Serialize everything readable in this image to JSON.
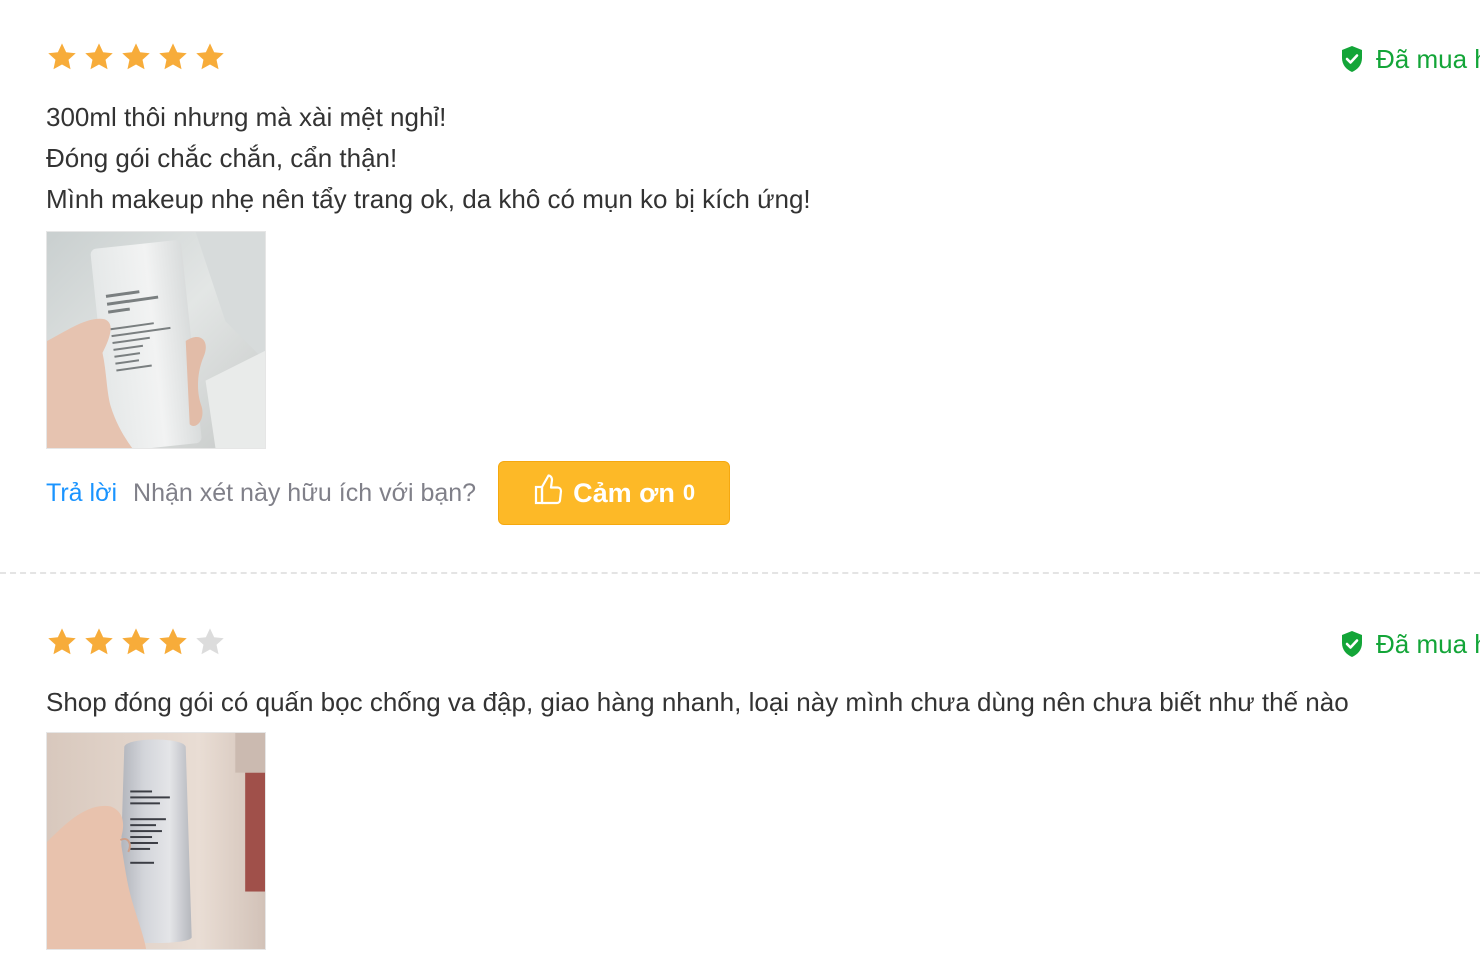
{
  "reviews": [
    {
      "rating": 5,
      "max_rating": 5,
      "verified_label": "Đã mua h",
      "lines": [
        "300ml thôi nhưng mà xài mệt nghỉ!",
        "Đóng gói chắc chắn, cẩn thận!",
        "Mình makeup nhẹ nên tẩy trang ok, da khô có mụn ko bị kích ứng!"
      ],
      "photo": "product-photo",
      "reply_label": "Trả lời",
      "helpful_question": "Nhận xét này hữu ích với bạn?",
      "thanks_label": "Cảm ơn",
      "thanks_count": "0"
    },
    {
      "rating": 4,
      "max_rating": 5,
      "verified_label": "Đã mua h",
      "lines": [
        "Shop đóng gói có quấn bọc chống va đập, giao hàng nhanh, loại này mình chưa dùng nên chưa biết như thế nào"
      ],
      "photo": "product-photo"
    }
  ],
  "colors": {
    "star_filled": "#f7ac3a",
    "star_empty": "#dcdcdc",
    "verified_green": "#13a538",
    "link_blue": "#1a94ff",
    "thanks_button": "#fdb927"
  },
  "icons": {
    "star": "star-icon",
    "verified": "verified-shield-icon",
    "thumbs_up": "thumbs-up-icon"
  }
}
